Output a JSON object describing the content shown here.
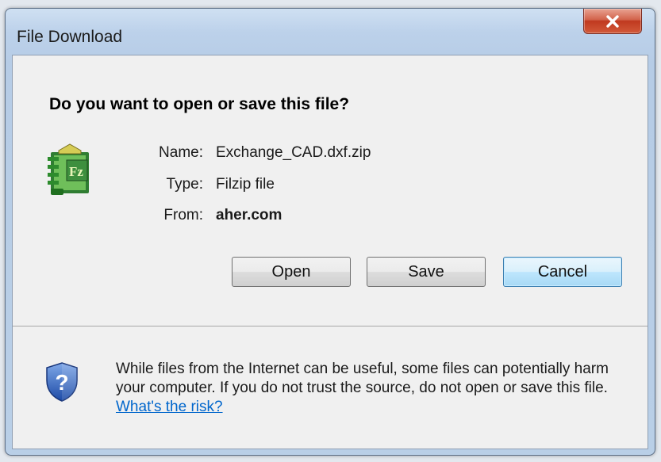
{
  "window": {
    "title": "File Download",
    "close_label": "Close"
  },
  "dialog": {
    "question": "Do you want to open or save this file?",
    "file": {
      "icon": "filzip-archive-icon",
      "name_label": "Name:",
      "name_value": "Exchange_CAD.dxf.zip",
      "type_label": "Type:",
      "type_value": "Filzip file",
      "from_label": "From:",
      "from_value": "aher.com"
    },
    "buttons": {
      "open": "Open",
      "save": "Save",
      "cancel": "Cancel"
    },
    "warning": {
      "icon": "security-shield-question-icon",
      "text": "While files from the Internet can be useful, some files can potentially harm your computer. If you do not trust the source, do not open or save this file.",
      "link": "What's the risk?"
    }
  },
  "colors": {
    "close_button": "#c7462c",
    "link": "#0066cc",
    "default_button_border": "#3c7fb1"
  }
}
